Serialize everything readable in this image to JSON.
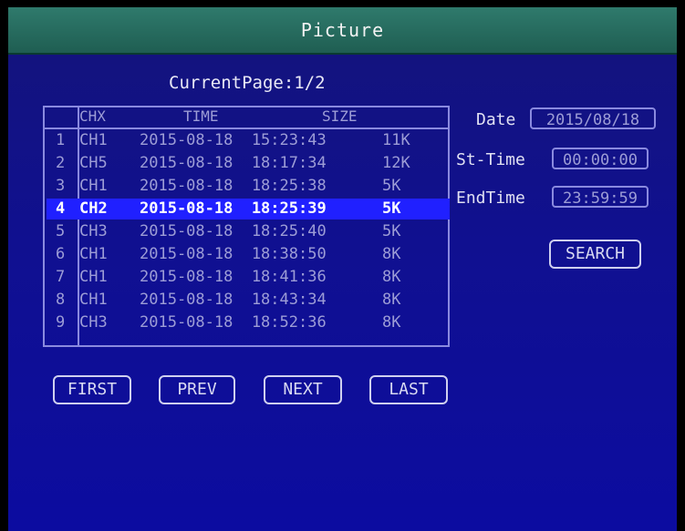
{
  "window": {
    "title": "Picture"
  },
  "pager": {
    "current_page_text": "CurrentPage:1/2"
  },
  "table": {
    "headers": {
      "index": "",
      "channel": "CHX",
      "time": "TIME",
      "size": "SIZE"
    },
    "rows": [
      {
        "index": "1",
        "channel": "CH1",
        "time": "2015-08-18  15:23:43",
        "size": "11K"
      },
      {
        "index": "2",
        "channel": "CH5",
        "time": "2015-08-18  18:17:34",
        "size": "12K"
      },
      {
        "index": "3",
        "channel": "CH1",
        "time": "2015-08-18  18:25:38",
        "size": "5K"
      },
      {
        "index": "4",
        "channel": "CH2",
        "time": "2015-08-18  18:25:39",
        "size": "5K"
      },
      {
        "index": "5",
        "channel": "CH3",
        "time": "2015-08-18  18:25:40",
        "size": "5K"
      },
      {
        "index": "6",
        "channel": "CH1",
        "time": "2015-08-18  18:38:50",
        "size": "8K"
      },
      {
        "index": "7",
        "channel": "CH1",
        "time": "2015-08-18  18:41:36",
        "size": "8K"
      },
      {
        "index": "8",
        "channel": "CH1",
        "time": "2015-08-18  18:43:34",
        "size": "8K"
      },
      {
        "index": "9",
        "channel": "CH3",
        "time": "2015-08-18  18:52:36",
        "size": "8K"
      }
    ],
    "selected_index": 3
  },
  "filters": {
    "date": {
      "label": "Date",
      "value": "2015/08/18"
    },
    "start_time": {
      "label": "St-Time",
      "value": "00:00:00"
    },
    "end_time": {
      "label": "EndTime",
      "value": "23:59:59"
    }
  },
  "buttons": {
    "search": "SEARCH",
    "first": "FIRST",
    "prev": "PREV",
    "next": "NEXT",
    "last": "LAST"
  },
  "colors": {
    "background": "#101090",
    "title_bar": "#2f7a6c",
    "selection": "#2020ff",
    "text_dim": "#9d9dd6",
    "text_bright": "#ffffff"
  }
}
